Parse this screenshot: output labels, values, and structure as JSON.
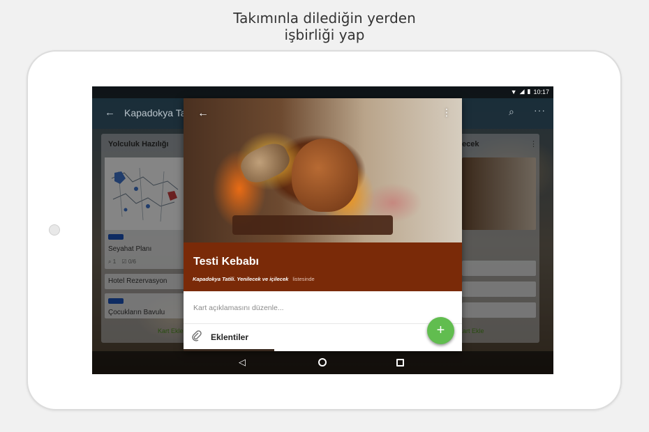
{
  "headline": {
    "line1": "Takımınla dilediğin yerden",
    "line2": "işbirliği yap"
  },
  "status_bar": {
    "time": "10:17",
    "icons": [
      "wifi-icon",
      "signal-icon",
      "battery-icon"
    ]
  },
  "board": {
    "title": "Kapadokya Ta",
    "lists": [
      {
        "title": "Yolculuk Hazılığı",
        "cards": [
          {
            "label_color": "#1a4fb3",
            "title": "Seyahat Planı",
            "attachments": "1",
            "checklist": "0/6"
          },
          {
            "title": "Hotel Rezervasyon"
          },
          {
            "label_color": "#1a4fb3",
            "title": "Çocukların Bavulu"
          }
        ],
        "add_card": "Kart Ekle"
      },
      {
        "title": "ecek",
        "add_card": "Kart Ekle"
      }
    ]
  },
  "card_detail": {
    "title": "Testi Kebabı",
    "location_board": "Kapadokya Tatili",
    "location_list": "Yenilecek ve içilecek",
    "location_suffix": "listesinde",
    "description_placeholder": "Kart açıklamasını düzenle...",
    "attachments_label": "Eklentiler",
    "fab_symbol": "+"
  },
  "colors": {
    "title_band": "#7a2a08",
    "fab": "#61bd4f",
    "label_blue": "#1a4fb3",
    "add_card_green": "#4a8a1c"
  }
}
